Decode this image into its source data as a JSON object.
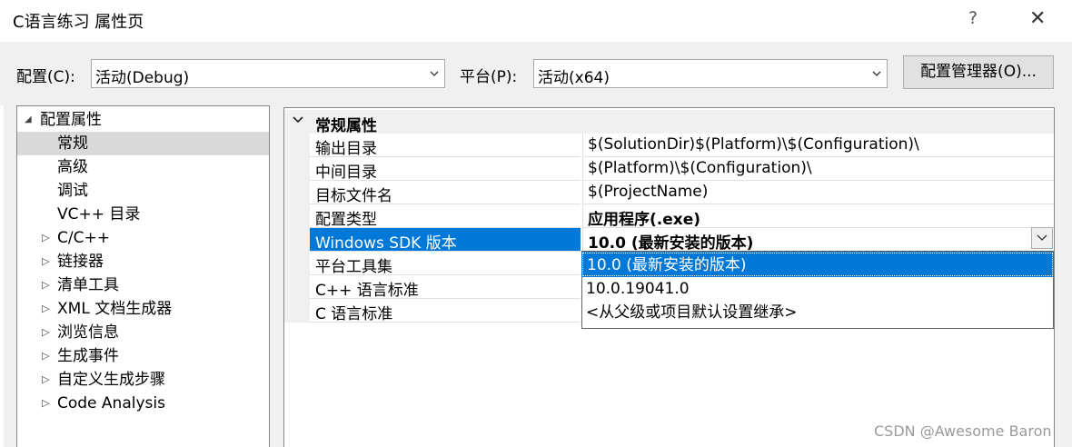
{
  "window": {
    "title": "C语言练习 属性页",
    "help": "?",
    "close": "✕"
  },
  "toolbar": {
    "config_label": "配置(C):",
    "config_value": "活动(Debug)",
    "platform_label": "平台(P):",
    "platform_value": "活动(x64)",
    "manager_button": "配置管理器(O)..."
  },
  "tree": {
    "items": [
      {
        "label": "配置属性",
        "expander": "◢",
        "state": "expanded"
      },
      {
        "label": "常规",
        "expander": "",
        "state": "selected"
      },
      {
        "label": "高级",
        "expander": ""
      },
      {
        "label": "调试",
        "expander": ""
      },
      {
        "label": "VC++ 目录",
        "expander": ""
      },
      {
        "label": "C/C++",
        "expander": "▷"
      },
      {
        "label": "链接器",
        "expander": "▷"
      },
      {
        "label": "清单工具",
        "expander": "▷"
      },
      {
        "label": "XML 文档生成器",
        "expander": "▷"
      },
      {
        "label": "浏览信息",
        "expander": "▷"
      },
      {
        "label": "生成事件",
        "expander": "▷"
      },
      {
        "label": "自定义生成步骤",
        "expander": "▷"
      },
      {
        "label": "Code Analysis",
        "expander": "▷"
      }
    ]
  },
  "grid": {
    "category": "常规属性",
    "rows": [
      {
        "name": "输出目录",
        "value": "$(SolutionDir)$(Platform)\\$(Configuration)\\"
      },
      {
        "name": "中间目录",
        "value": "$(Platform)\\$(Configuration)\\"
      },
      {
        "name": "目标文件名",
        "value": "$(ProjectName)"
      },
      {
        "name": "配置类型",
        "value": "应用程序(.exe)"
      },
      {
        "name": "Windows SDK 版本",
        "value": "10.0 (最新安装的版本)"
      },
      {
        "name": "平台工具集",
        "value": ""
      },
      {
        "name": "C++ 语言标准",
        "value": ""
      },
      {
        "name": "C 语言标准",
        "value": ""
      }
    ]
  },
  "dropdown": {
    "options": [
      "10.0 (最新安装的版本)",
      "10.0.19041.0",
      "<从父级或项目默认设置继承>"
    ],
    "selected_index": 0
  },
  "watermark": "CSDN @Awesome Baron",
  "colors": {
    "selection": "#0078d7",
    "tree_selection": "#d9d9d9",
    "panel_bg": "#f0f0f0"
  }
}
